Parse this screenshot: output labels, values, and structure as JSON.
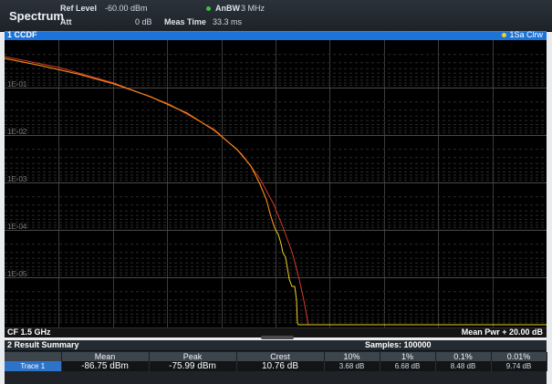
{
  "header": {
    "app_title": "Spectrum",
    "ref_level_label": "Ref Level",
    "ref_level_value": "-60.00 dBm",
    "att_label": "Att",
    "att_value": "0 dB",
    "meas_time_label": "Meas Time",
    "meas_time_value": "33.3 ms",
    "anbw_label": "AnBW",
    "anbw_value": "3 MHz",
    "anbw_indicator_color": "#3fbf4a"
  },
  "window": {
    "title": "1 CCDF",
    "trace_indicator": "1Sa Clrw",
    "bottom_left": "CF 1.5 GHz",
    "bottom_right": "Mean Pwr + 20.00 dB",
    "y_tick_labels": [
      "1E-01",
      "1E-02",
      "1E-03",
      "1E-04",
      "1E-05"
    ]
  },
  "results": {
    "title": "2 Result Summary",
    "samples": "Samples: 100000",
    "headers": [
      "",
      "Mean",
      "Peak",
      "Crest",
      "10%",
      "1%",
      "0.1%",
      "0.01%"
    ],
    "rows": [
      {
        "label": "Trace 1",
        "mean": "-86.75 dBm",
        "peak": "-75.99 dBm",
        "crest": "10.76 dB",
        "p10": "3.68 dB",
        "p1": "6.68 dB",
        "p01": "8.48 dB",
        "p001": "9.74 dB"
      }
    ]
  },
  "colors": {
    "accent_blue": "#1e73d8",
    "trace_yellow": "#f1d21f",
    "trace_orange": "#f07d1a",
    "reference_red": "#d43a2a"
  }
}
